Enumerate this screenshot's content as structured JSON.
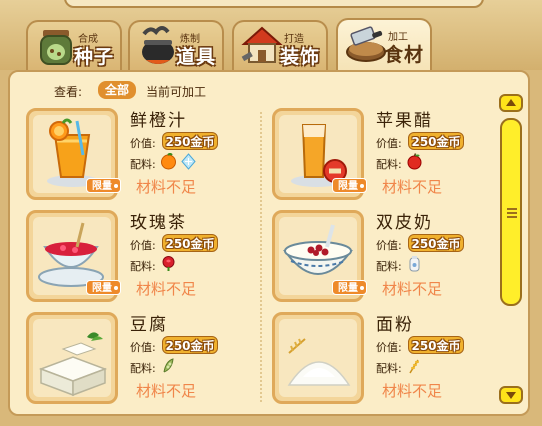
{
  "tabs": [
    {
      "small": "合成",
      "big": "种子",
      "icon": "seed-jar-icon",
      "active": false
    },
    {
      "small": "炼制",
      "big": "道具",
      "icon": "cauldron-icon",
      "active": false
    },
    {
      "small": "打造",
      "big": "装饰",
      "icon": "house-icon",
      "active": false
    },
    {
      "small": "加工",
      "big": "食材",
      "icon": "cutting-board-icon",
      "active": true
    }
  ],
  "filter": {
    "label": "查看:",
    "all": "全部",
    "current": "当前可加工"
  },
  "items": [
    {
      "name": "鲜橙汁",
      "price_label": "价值:",
      "price": "250金币",
      "mat_label": "配料:",
      "materials": [
        "orange-icon",
        "ice-icon"
      ],
      "limited": "限量",
      "status": "材料不足",
      "image": "orange-juice-icon"
    },
    {
      "name": "苹果醋",
      "price_label": "价值:",
      "price": "250金币",
      "mat_label": "配料:",
      "materials": [
        "apple-icon"
      ],
      "limited": "限量",
      "status": "材料不足",
      "image": "apple-vinegar-icon"
    },
    {
      "name": "玫瑰茶",
      "price_label": "价值:",
      "price": "250金币",
      "mat_label": "配料:",
      "materials": [
        "rose-icon"
      ],
      "limited": "限量",
      "status": "材料不足",
      "image": "rose-tea-icon"
    },
    {
      "name": "双皮奶",
      "price_label": "价值:",
      "price": "250金币",
      "mat_label": "配料:",
      "materials": [
        "milk-icon"
      ],
      "limited": "限量",
      "status": "材料不足",
      "image": "double-skin-milk-icon"
    },
    {
      "name": "豆腐",
      "price_label": "价值:",
      "price": "250金币",
      "mat_label": "配料:",
      "materials": [
        "soybean-icon"
      ],
      "limited": "",
      "status": "材料不足",
      "image": "tofu-icon"
    },
    {
      "name": "面粉",
      "price_label": "价值:",
      "price": "250金币",
      "mat_label": "配料:",
      "materials": [
        "wheat-icon"
      ],
      "limited": "",
      "status": "材料不足",
      "image": "flour-icon"
    }
  ],
  "colors": {
    "accent": "#e08f2e",
    "status": "#f0864a",
    "price": "#f0b12e",
    "scrollbar": "#ffee2a"
  }
}
